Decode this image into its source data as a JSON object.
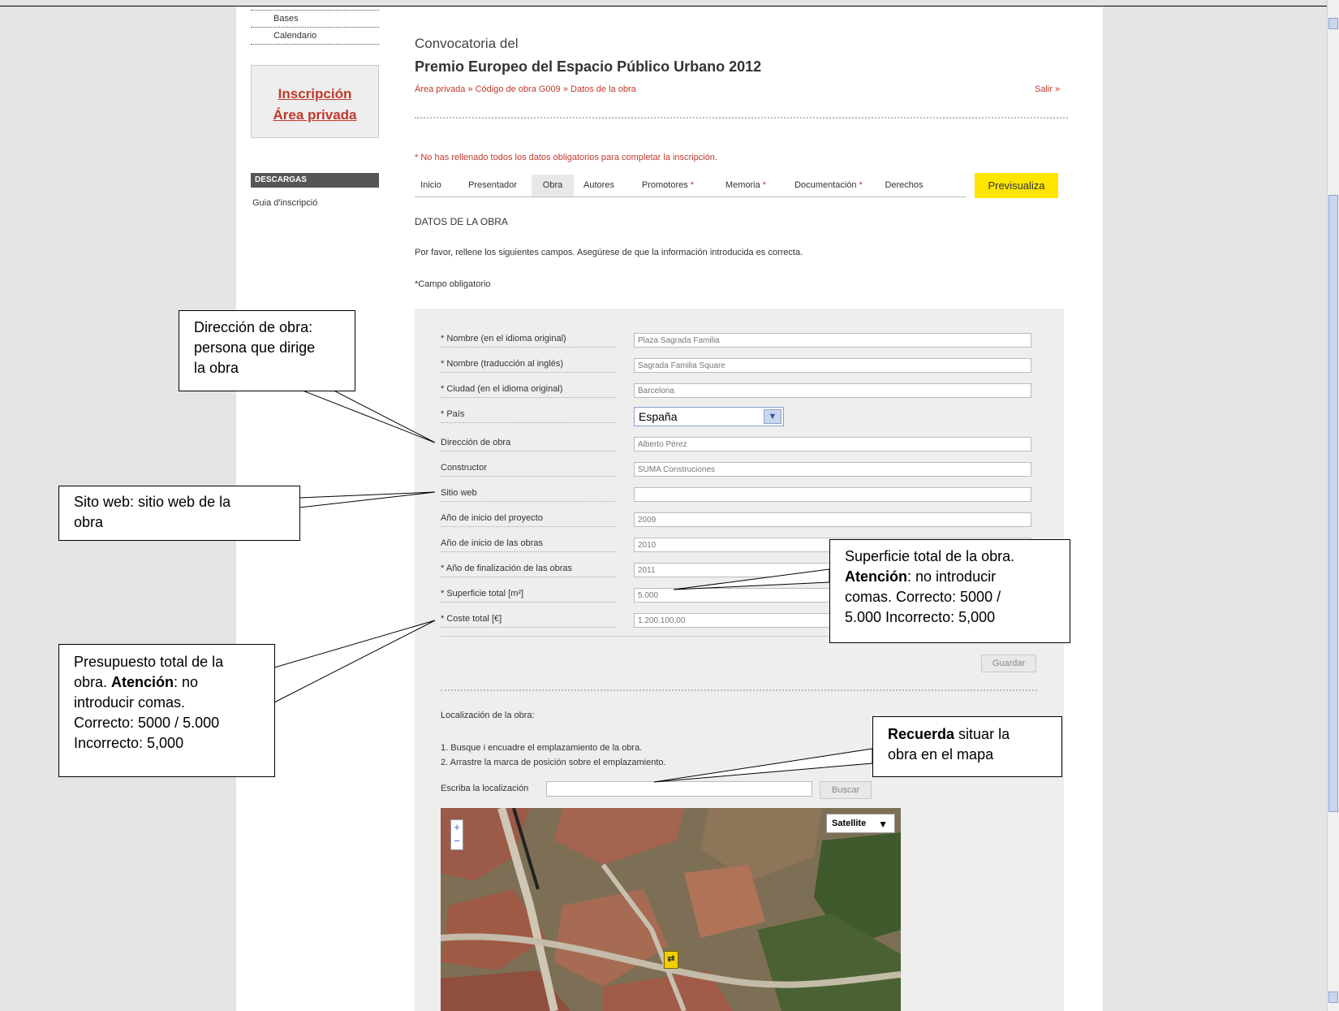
{
  "sidebar": {
    "links": [
      "Bases",
      "Calendario"
    ],
    "register_line1": "Inscripción",
    "register_line2": "Área privada",
    "downloads_heading": "DESCARGAS",
    "download_link": "Guia d'inscripció"
  },
  "header": {
    "convocatoria": "Convocatoria del",
    "title": "Premio Europeo del Espacio Público Urbano 2012",
    "breadcrumb": "Área privada »  Código de obra G009 »  Datos de la obra",
    "logout": "Salir »"
  },
  "warning": "* No has rellenado todos los datos obligatorios para completar la inscripción.",
  "tabs": [
    {
      "label": "Inicio",
      "star": ""
    },
    {
      "label": "Presentador",
      "star": ""
    },
    {
      "label": "Obra",
      "star": ""
    },
    {
      "label": "Autores",
      "star": ""
    },
    {
      "label": "Promotores",
      "star": " *"
    },
    {
      "label": "Memoria",
      "star": " *"
    },
    {
      "label": "Documentación",
      "star": " *"
    },
    {
      "label": "Derechos",
      "star": ""
    }
  ],
  "preview_button": "Previsualiza",
  "section_title": "DATOS DE LA OBRA",
  "intro_text": "Por favor, rellene los siguientes campos. Asegúrese de que la información introducida es correcta.",
  "required_note": "*Campo obligatorio",
  "form": {
    "fields": [
      {
        "label": "* Nombre (en el idioma original)",
        "value": "Plaza Sagrada Familia"
      },
      {
        "label": "* Nombre (traducción al inglés)",
        "value": "Sagrada Familia Square"
      },
      {
        "label": "* Ciudad (en el idioma original)",
        "value": "Barcelona"
      },
      {
        "label": "* País",
        "value": "España"
      },
      {
        "label": "Dirección de obra",
        "value": "Alberto Pérez"
      },
      {
        "label": "Constructor",
        "value": "SUMA Construciones"
      },
      {
        "label": "Sitio web",
        "value": ""
      },
      {
        "label": "Año de inicio del proyecto",
        "value": "2009"
      },
      {
        "label": "Año de inicio de las obras",
        "value": "2010"
      },
      {
        "label": "* Año de finalización de las obras",
        "value": "2011"
      },
      {
        "label": "* Superficie total [m²]",
        "value": "5.000"
      },
      {
        "label": "* Coste total [€]",
        "value": "1.200.100,00"
      }
    ],
    "save_button": "Guardar"
  },
  "location": {
    "title": "Localización de la obra:",
    "step1": "1. Busque i encuadre el emplazamiento de la obra.",
    "step2": "2. Arrastre la marca de posición sobre el emplazamiento.",
    "input_label": "Escriba la localización",
    "search_button": "Buscar",
    "map_type": "Satellite",
    "zoom_in": "+",
    "zoom_out": "−"
  },
  "annotations": {
    "direccion": [
      "Dirección de obra:",
      "persona que dirige",
      "la obra"
    ],
    "sitio": [
      "Sito web: sitio web de la",
      "obra"
    ],
    "presupuesto": {
      "line1": "Presupuesto total de la",
      "line2_pre": "obra. ",
      "line2_bold": "Atención",
      "line2_post": ": no",
      "line3": "introducir comas.",
      "line4": "Correcto: 5000 / 5.000",
      "line5": "Incorrecto: 5,000"
    },
    "superficie": {
      "line1": "Superficie total de la obra.",
      "line2_bold": "Atención",
      "line2_post": ": no introducir",
      "line3": "comas. Correcto: 5000 /",
      "line4": "5.000 Incorrecto: 5,000"
    },
    "recuerda": {
      "bold": "Recuerda",
      "line1_post": " situar la",
      "line2": "obra en el mapa"
    }
  },
  "colors": {
    "accent_red": "#c0392b",
    "preview_yellow": "#ffe600",
    "form_bg": "#eeeeee"
  }
}
